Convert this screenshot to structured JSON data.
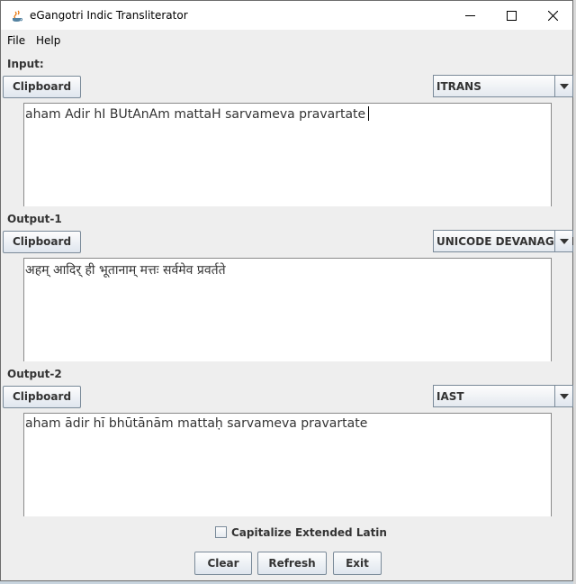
{
  "window": {
    "title": "eGangotri Indic Transliterator"
  },
  "menu": [
    "File",
    "Help"
  ],
  "sections": {
    "input": {
      "label": "Input:",
      "clipboard_label": "Clipboard",
      "scheme": "ITRANS",
      "text": "aham Adir hI BUtAnAm mattaH sarvameva pravartate"
    },
    "output1": {
      "label": "Output-1",
      "clipboard_label": "Clipboard",
      "scheme": "UNICODE DEVANAGARI",
      "text": "अहम् आदिर् ही भूतानाम् मत्तः सर्वमेव प्रवर्तते"
    },
    "output2": {
      "label": "Output-2",
      "clipboard_label": "Clipboard",
      "scheme": "IAST",
      "text": "aham ādir hī bhūtānām mattaḥ sarvameva pravartate"
    }
  },
  "options": {
    "capitalize_label": "Capitalize Extended Latin",
    "capitalize_checked": false
  },
  "buttons": {
    "clear": "Clear",
    "refresh": "Refresh",
    "exit": "Exit"
  }
}
